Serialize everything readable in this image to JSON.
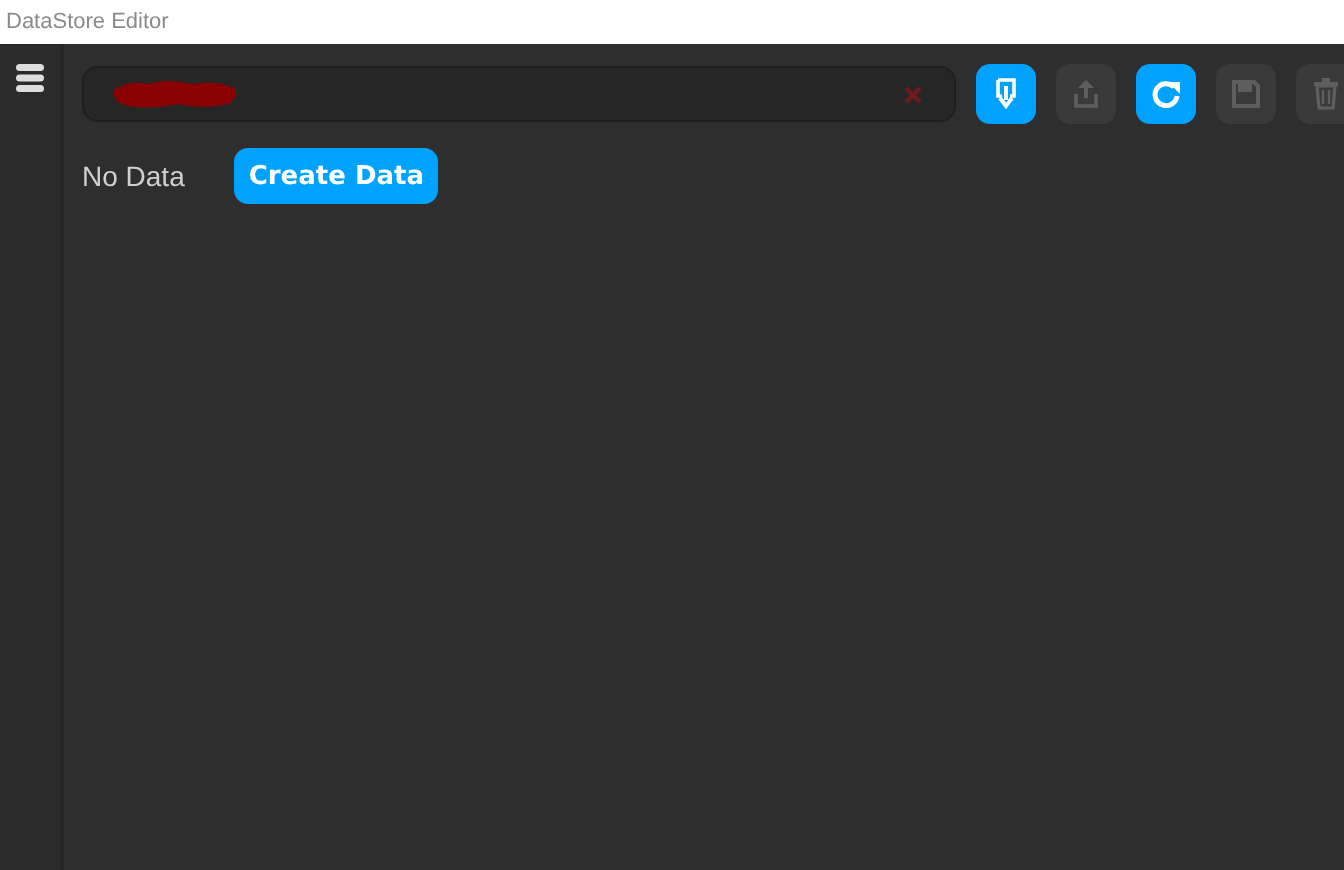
{
  "window": {
    "title": "DataStore Editor"
  },
  "key_field": {
    "redacted": true
  },
  "toolbar": [
    {
      "kind": "download",
      "disabled": false
    },
    {
      "kind": "upload",
      "disabled": true
    },
    {
      "kind": "refresh",
      "disabled": false
    },
    {
      "kind": "save",
      "disabled": true
    },
    {
      "kind": "delete",
      "disabled": true
    }
  ],
  "status": "No Data",
  "create_button": "Create Data"
}
